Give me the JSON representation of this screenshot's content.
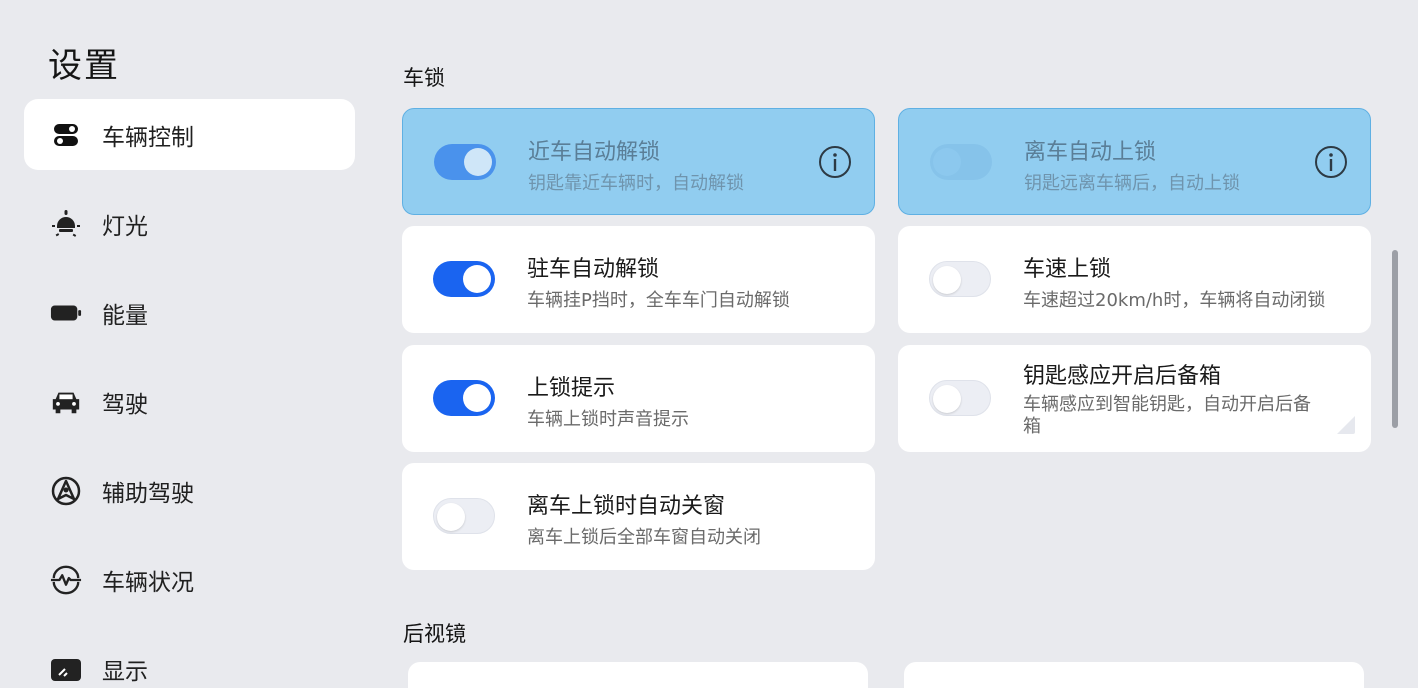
{
  "page_title": "设置",
  "sidebar": {
    "items": [
      {
        "label": "车辆控制",
        "icon": "vehicle-control-icon",
        "active": true
      },
      {
        "label": "灯光",
        "icon": "light-icon"
      },
      {
        "label": "能量",
        "icon": "battery-icon"
      },
      {
        "label": "驾驶",
        "icon": "car-icon"
      },
      {
        "label": "辅助驾驶",
        "icon": "assist-driving-icon"
      },
      {
        "label": "车辆状况",
        "icon": "vehicle-status-icon"
      },
      {
        "label": "显示",
        "icon": "display-icon"
      }
    ]
  },
  "sections": {
    "lock": {
      "title": "车锁",
      "cards": [
        {
          "title": "近车自动解锁",
          "desc": "钥匙靠近车辆时，自动解锁",
          "toggle": "on",
          "highlight": true,
          "info": true
        },
        {
          "title": "离车自动上锁",
          "desc": "钥匙远离车辆后，自动上锁",
          "toggle": "off",
          "highlight": true,
          "info": true
        },
        {
          "title": "驻车自动解锁",
          "desc": "车辆挂P挡时，全车车门自动解锁",
          "toggle": "on"
        },
        {
          "title": "车速上锁",
          "desc": "车速超过20km/h时，车辆将自动闭锁",
          "toggle": "off"
        },
        {
          "title": "上锁提示",
          "desc": "车辆上锁时声音提示",
          "toggle": "on"
        },
        {
          "title": "钥匙感应开启后备箱",
          "desc": "车辆感应到智能钥匙，自动开启后备箱",
          "toggle": "off"
        },
        {
          "title": "离车上锁时自动关窗",
          "desc": "离车上锁后全部车窗自动关闭",
          "toggle": "off"
        }
      ]
    },
    "mirror": {
      "title": "后视镜"
    }
  },
  "colors": {
    "background": "#e9eaee",
    "toggle_on": "#1a64f0",
    "highlight": "#91cdf0"
  }
}
